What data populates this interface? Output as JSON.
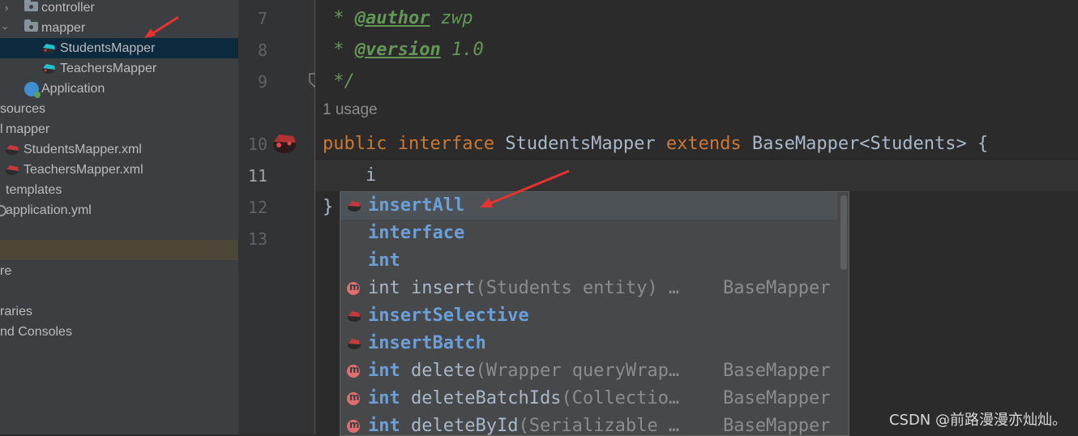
{
  "tree": {
    "items": [
      {
        "label": "controller"
      },
      {
        "label": "mapper"
      },
      {
        "label": "StudentsMapper"
      },
      {
        "label": "TeachersMapper"
      },
      {
        "label": "Application"
      },
      {
        "label": "sources"
      },
      {
        "label": "mapper"
      },
      {
        "label": "StudentsMapper.xml"
      },
      {
        "label": "TeachersMapper.xml"
      },
      {
        "label": "templates"
      },
      {
        "label": "application.yml"
      },
      {
        "label": "re"
      },
      {
        "label": ""
      },
      {
        "label": "raries"
      },
      {
        "label": "nd Consoles"
      }
    ]
  },
  "gutter": {
    "line_numbers": [
      "7",
      "8",
      "9",
      "10",
      "11",
      "12",
      "13"
    ]
  },
  "editor": {
    "line7_star": " * ",
    "line7_tag": "@author",
    "line7_val": " zwp",
    "line8_star": " * ",
    "line8_tag": "@version",
    "line8_val": " 1.0",
    "line9": " */",
    "usage_hint": "1 usage",
    "line10": {
      "kw_public": "public",
      "kw_interface": "interface",
      "name": "StudentsMapper",
      "kw_extends": "extends",
      "base": "BaseMapper<Students> {"
    },
    "line11": "    i",
    "line12": "}"
  },
  "completion": {
    "items": [
      {
        "name": "insertAll",
        "icon": "mybatis-icon"
      },
      {
        "name": "interface",
        "icon": ""
      },
      {
        "name": "int",
        "icon": ""
      },
      {
        "type": "int",
        "name": "insert",
        "sig": "(Students entity) …",
        "source": "BaseMapper",
        "icon": "method-icon"
      },
      {
        "name": "insertSelective",
        "icon": "mybatis-icon"
      },
      {
        "name": "insertBatch",
        "icon": "mybatis-icon"
      },
      {
        "type": "int",
        "name": "delete",
        "sig": "(Wrapper queryWrap…",
        "source": "BaseMapper",
        "icon": "method-icon"
      },
      {
        "type": "int",
        "name": "deleteBatchIds",
        "sig": "(Collectio…",
        "source": "BaseMapper",
        "icon": "method-icon"
      },
      {
        "type": "int",
        "name": "deleteById",
        "sig": "(Serializable …",
        "source": "BaseMapper",
        "icon": "method-icon"
      }
    ]
  },
  "watermark": "CSDN @前路漫漫亦灿灿。",
  "colors": {
    "keyword": "#cc7832",
    "doc_comment": "#629755",
    "plain": "#a9b7c6",
    "completion_match": "#6a9fd8",
    "annotation_arrow": "#e8322f"
  }
}
